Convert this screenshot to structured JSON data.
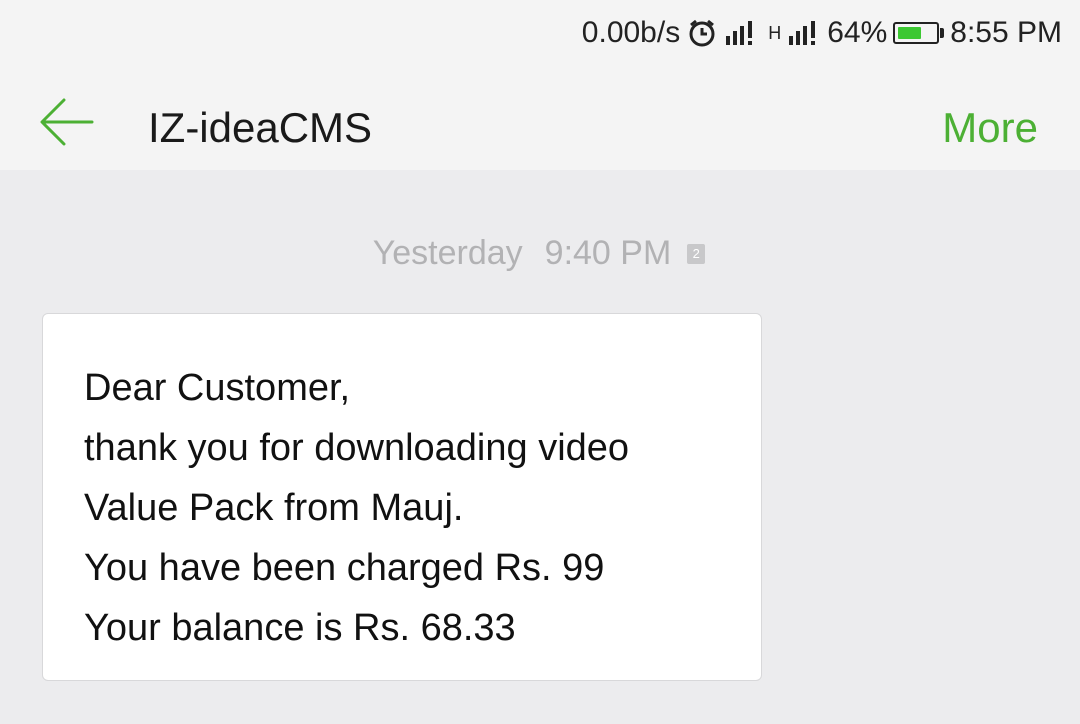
{
  "status_bar": {
    "network_speed": "0.00b/s",
    "network_type": "H",
    "battery_percent": "64%",
    "battery_level": 0.64,
    "time": "8:55 PM"
  },
  "header": {
    "title": "IZ-ideaCMS",
    "more_label": "More"
  },
  "message": {
    "day": "Yesterday",
    "time": "9:40 PM",
    "sim": "2",
    "lines": [
      "Dear Customer,",
      "thank you for downloading video",
      "Value Pack from Mauj.",
      "You have been charged Rs. 99",
      "Your balance is Rs. 68.33"
    ]
  },
  "colors": {
    "accent": "#4cb034",
    "battery": "#3cc832",
    "background": "#ececee"
  }
}
